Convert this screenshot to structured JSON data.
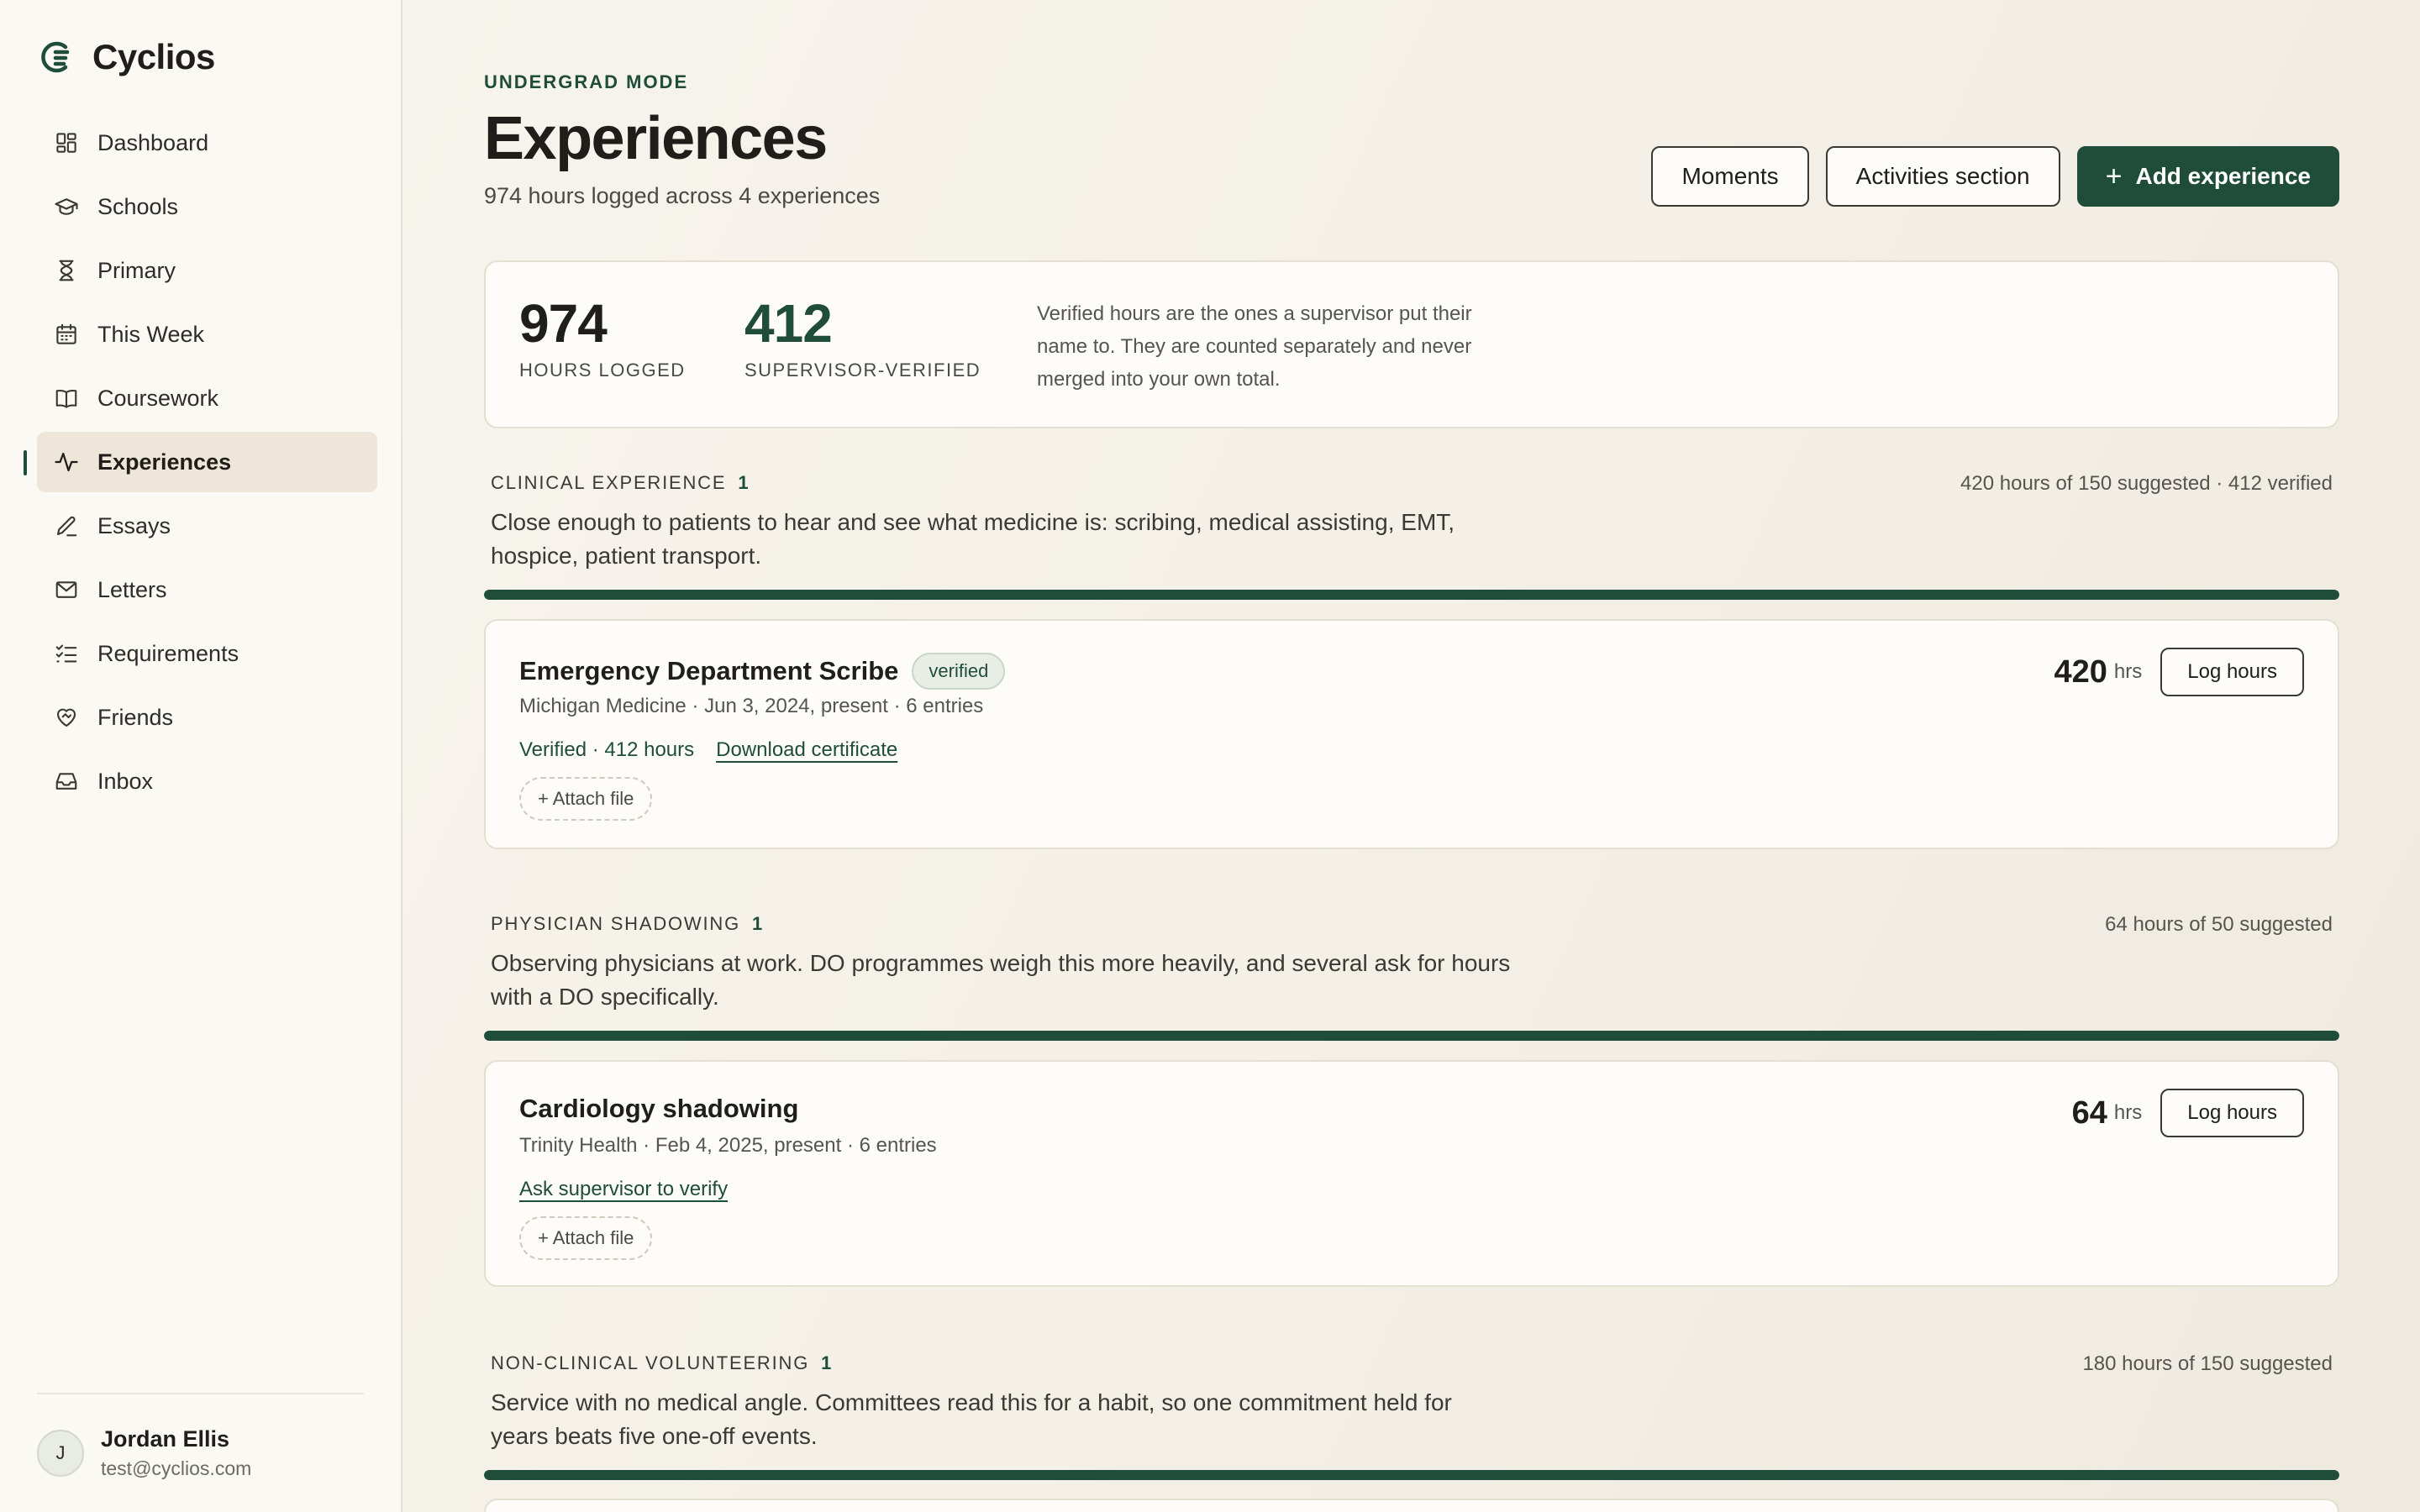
{
  "brand": {
    "name": "Cyclios"
  },
  "sidebar": {
    "items": [
      {
        "label": "Dashboard",
        "icon": "grid-icon"
      },
      {
        "label": "Schools",
        "icon": "graduation-cap-icon"
      },
      {
        "label": "Primary",
        "icon": "hourglass-icon"
      },
      {
        "label": "This Week",
        "icon": "calendar-icon"
      },
      {
        "label": "Coursework",
        "icon": "book-icon"
      },
      {
        "label": "Experiences",
        "icon": "activity-icon",
        "active": true
      },
      {
        "label": "Essays",
        "icon": "pen-icon"
      },
      {
        "label": "Letters",
        "icon": "mail-icon"
      },
      {
        "label": "Requirements",
        "icon": "checklist-icon"
      },
      {
        "label": "Friends",
        "icon": "heart-handshake-icon"
      },
      {
        "label": "Inbox",
        "icon": "inbox-icon"
      }
    ]
  },
  "user": {
    "initial": "J",
    "name": "Jordan Ellis",
    "email": "test@cyclios.com"
  },
  "header": {
    "mode": "UNDERGRAD MODE",
    "title": "Experiences",
    "subtitle": "974 hours logged across 4 experiences",
    "buttons": {
      "moments": "Moments",
      "activities": "Activities section",
      "add": "Add experience"
    }
  },
  "stats": {
    "hours_logged": {
      "value": "974",
      "label": "HOURS LOGGED"
    },
    "verified": {
      "value": "412",
      "label": "SUPERVISOR-VERIFIED"
    },
    "note": "Verified hours are the ones a supervisor put their name to. They are counted separately and never merged into your own total."
  },
  "sections": [
    {
      "label": "CLINICAL EXPERIENCE",
      "count": "1",
      "summary": "420 hours of 150 suggested · 412 verified",
      "description": "Close enough to patients to hear and see what medicine is: scribing, medical assisting, EMT, hospice, patient transport.",
      "progress": 1.0,
      "experience": {
        "title": "Emergency Department Scribe",
        "badge": "verified",
        "meta": "Michigan Medicine · Jun 3, 2024, present · 6 entries",
        "verified_text": "Verified · 412 hours",
        "link": "Download certificate",
        "attach": "+ Attach file",
        "hours": "420",
        "hours_unit": "hrs",
        "log_button": "Log hours"
      }
    },
    {
      "label": "PHYSICIAN SHADOWING",
      "count": "1",
      "summary": "64 hours of 50 suggested",
      "description": "Observing physicians at work. DO programmes weigh this more heavily, and several ask for hours with a DO specifically.",
      "progress": 1.0,
      "experience": {
        "title": "Cardiology shadowing",
        "meta": "Trinity Health · Feb 4, 2025, present · 6 entries",
        "link": "Ask supervisor to verify",
        "attach": "+ Attach file",
        "hours": "64",
        "hours_unit": "hrs",
        "log_button": "Log hours"
      }
    },
    {
      "label": "NON-CLINICAL VOLUNTEERING",
      "count": "1",
      "summary": "180 hours of 150 suggested",
      "description": "Service with no medical angle. Committees read this for a habit, so one commitment held for years beats five one-off events.",
      "progress": 1.0
    }
  ],
  "colors": {
    "accent": "#1f4d3a",
    "active_nav": "#ede6d9",
    "card": "#fdfcf8"
  }
}
